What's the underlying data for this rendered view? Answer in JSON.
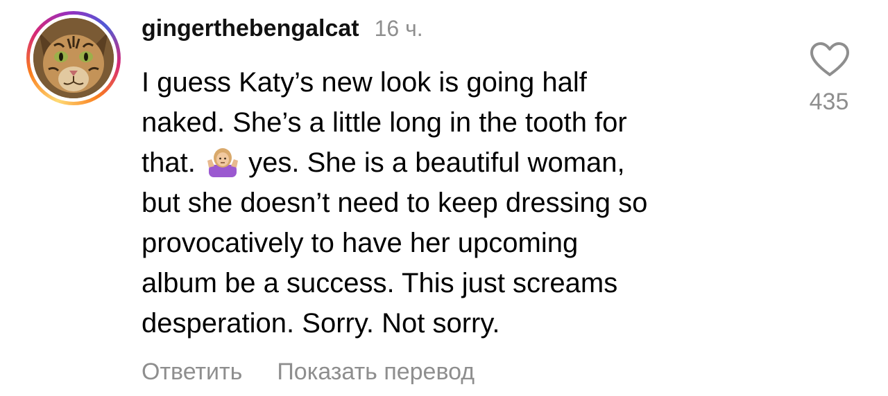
{
  "comment": {
    "username": "gingerthebengalcat",
    "time": "16 ч.",
    "avatar_icon": "bengal-cat-avatar",
    "text_lines": [
      "I guess Katy’s new look is going half",
      "naked. She’s a little long in the tooth for",
      "that.",
      "yes. She is a beautiful woman,",
      "but she doesn’t need to keep dressing so",
      "provocatively to have her upcoming",
      "album be a success. This just screams",
      "desperation. Sorry. Not sorry."
    ],
    "emoji": "woman-shrugging-emoji",
    "likes": "435",
    "like_icon": "heart-outline-icon"
  },
  "actions": {
    "reply_label": "Ответить",
    "translate_label": "Показать перевод"
  },
  "colors": {
    "text": "#000000",
    "secondary_text": "#8e8e8e",
    "story_ring": [
      "#feda75",
      "#fa7e1e",
      "#d62976",
      "#962fbf",
      "#4f5bd5"
    ]
  }
}
